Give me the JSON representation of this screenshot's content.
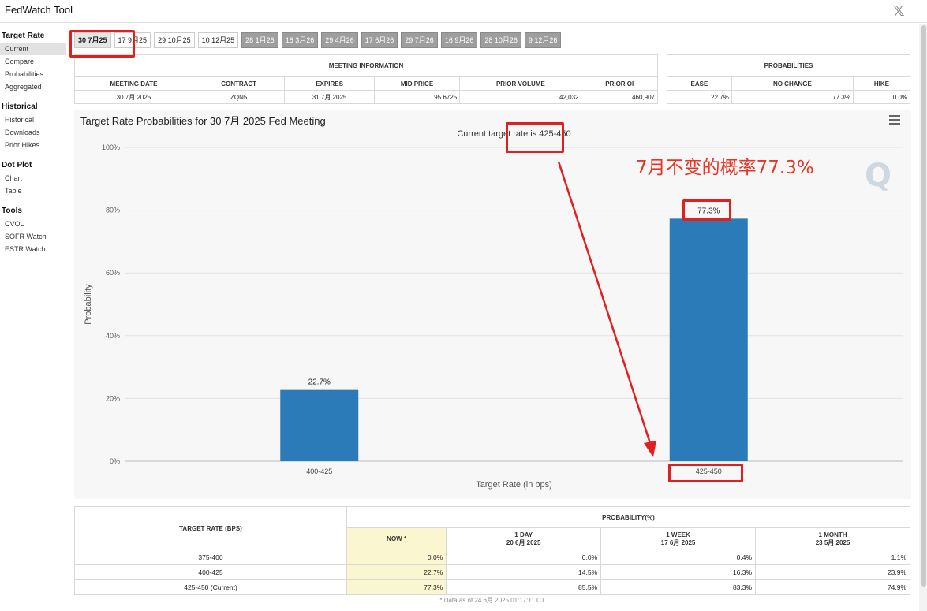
{
  "app": {
    "title": "FedWatch Tool",
    "close_icon": "x-logo-icon"
  },
  "sidebar": {
    "groups": [
      {
        "title": "Target Rate",
        "items": [
          "Current",
          "Compare",
          "Probabilities",
          "Aggregated"
        ],
        "active": "Current"
      },
      {
        "title": "Historical",
        "items": [
          "Historical",
          "Downloads",
          "Prior Hikes"
        ]
      },
      {
        "title": "Dot Plot",
        "items": [
          "Chart",
          "Table"
        ]
      },
      {
        "title": "Tools",
        "items": [
          "CVOL",
          "SOFR Watch",
          "ESTR Watch"
        ]
      }
    ]
  },
  "meeting_tabs": [
    {
      "label": "30 7月25",
      "state": "selected"
    },
    {
      "label": "17 9月25",
      "state": "normal"
    },
    {
      "label": "29 10月25",
      "state": "normal"
    },
    {
      "label": "10 12月25",
      "state": "normal"
    },
    {
      "label": "28 1月26",
      "state": "dim"
    },
    {
      "label": "18 3月26",
      "state": "dim"
    },
    {
      "label": "29 4月26",
      "state": "dim"
    },
    {
      "label": "17 6月26",
      "state": "dim"
    },
    {
      "label": "29 7月26",
      "state": "dim"
    },
    {
      "label": "16 9月26",
      "state": "dim"
    },
    {
      "label": "28 10月26",
      "state": "dim"
    },
    {
      "label": "9 12月26",
      "state": "dim"
    }
  ],
  "meeting_info": {
    "caption": "MEETING INFORMATION",
    "headers": [
      "MEETING DATE",
      "CONTRACT",
      "EXPIRES",
      "MID PRICE",
      "PRIOR VOLUME",
      "PRIOR OI"
    ],
    "values": [
      "30 7月 2025",
      "ZQN5",
      "31 7月 2025",
      "95.6725",
      "42,032",
      "460,907"
    ]
  },
  "probabilities": {
    "caption": "PROBABILITIES",
    "headers": [
      "EASE",
      "NO CHANGE",
      "HIKE"
    ],
    "values": [
      "22.7%",
      "77.3%",
      "0.0%"
    ]
  },
  "chart_header": {
    "title": "Target Rate Probabilities for 30 7月 2025 Fed Meeting",
    "menu_icon": "hamburger-menu-icon"
  },
  "chart_data": {
    "type": "bar",
    "title": "Target Rate Probabilities for 30 7月 2025 Fed Meeting",
    "subtitle": "Current target rate is 425-450",
    "categories": [
      "400-425",
      "425-450"
    ],
    "values": [
      22.7,
      77.3
    ],
    "data_labels": [
      "22.7%",
      "77.3%"
    ],
    "xlabel": "Target Rate (in bps)",
    "ylabel": "Probability",
    "ylim": [
      0,
      100
    ],
    "yticks": [
      "0%",
      "20%",
      "40%",
      "60%",
      "80%",
      "100%"
    ],
    "grid": true,
    "bar_color": "#2b7bb9"
  },
  "annotation": {
    "text": "7月不变的概率77.3%",
    "color": "#ea3323"
  },
  "prob_table": {
    "col_rate": "TARGET RATE (BPS)",
    "col_group": "PROBABILITY(%)",
    "periods": [
      {
        "label": "NOW *",
        "date": ""
      },
      {
        "label": "1 DAY",
        "date": "20 6月 2025"
      },
      {
        "label": "1 WEEK",
        "date": "17 6月 2025"
      },
      {
        "label": "1 MONTH",
        "date": "23 5月 2025"
      }
    ],
    "rows": [
      {
        "rate": "375-400",
        "values": [
          "0.0%",
          "0.0%",
          "0.4%",
          "1.1%"
        ]
      },
      {
        "rate": "400-425",
        "values": [
          "22.7%",
          "14.5%",
          "16.3%",
          "23.9%"
        ]
      },
      {
        "rate": "425-450 (Current)",
        "values": [
          "77.3%",
          "85.5%",
          "83.3%",
          "74.9%"
        ]
      }
    ],
    "footnote": "* Data as of 24 6月 2025 01:17:11 CT"
  }
}
